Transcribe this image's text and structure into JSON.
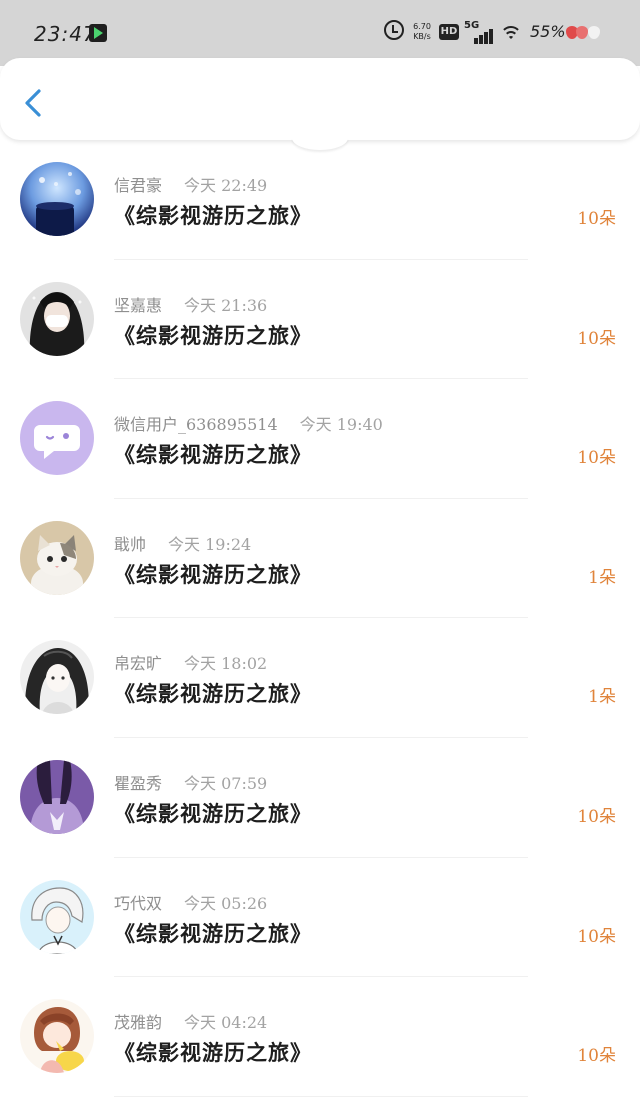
{
  "status_bar": {
    "time": "23:47",
    "net_speed_value": "6.70",
    "net_speed_unit": "KB/s",
    "hd_label": "HD",
    "network_label": "5G",
    "battery": "55%"
  },
  "colors": {
    "accent_back": "#3a8fd6",
    "amount_color": "#e0843b",
    "status_bar_bg": "#d5d5d5"
  },
  "rows": [
    {
      "name": "信君豪",
      "time": "今天 22:49",
      "book": "《综影视游历之旅》",
      "amount": "10朵",
      "avatar": "avatar-icon-winter-mug"
    },
    {
      "name": "坚嘉惠",
      "time": "今天 21:36",
      "book": "《综影视游历之旅》",
      "amount": "10朵",
      "avatar": "avatar-icon-girl-mask"
    },
    {
      "name": "微信用户_636895514",
      "time": "今天 19:40",
      "book": "《综影视游历之旅》",
      "amount": "10朵",
      "avatar": "avatar-icon-default-chat"
    },
    {
      "name": "戢帅",
      "time": "今天 19:24",
      "book": "《综影视游历之旅》",
      "amount": "1朵",
      "avatar": "avatar-icon-cat"
    },
    {
      "name": "帛宏旷",
      "time": "今天 18:02",
      "book": "《综影视游历之旅》",
      "amount": "1朵",
      "avatar": "avatar-icon-ink-girl"
    },
    {
      "name": "瞿盈秀",
      "time": "今天 07:59",
      "book": "《综影视游历之旅》",
      "amount": "10朵",
      "avatar": "avatar-icon-purple-girl"
    },
    {
      "name": "巧代双",
      "time": "今天 05:26",
      "book": "《综影视游历之旅》",
      "amount": "10朵",
      "avatar": "avatar-icon-anime-boy"
    },
    {
      "name": "茂雅韵",
      "time": "今天 04:24",
      "book": "《综影视游历之旅》",
      "amount": "10朵",
      "avatar": "avatar-icon-anime-girl-pikachu"
    }
  ]
}
